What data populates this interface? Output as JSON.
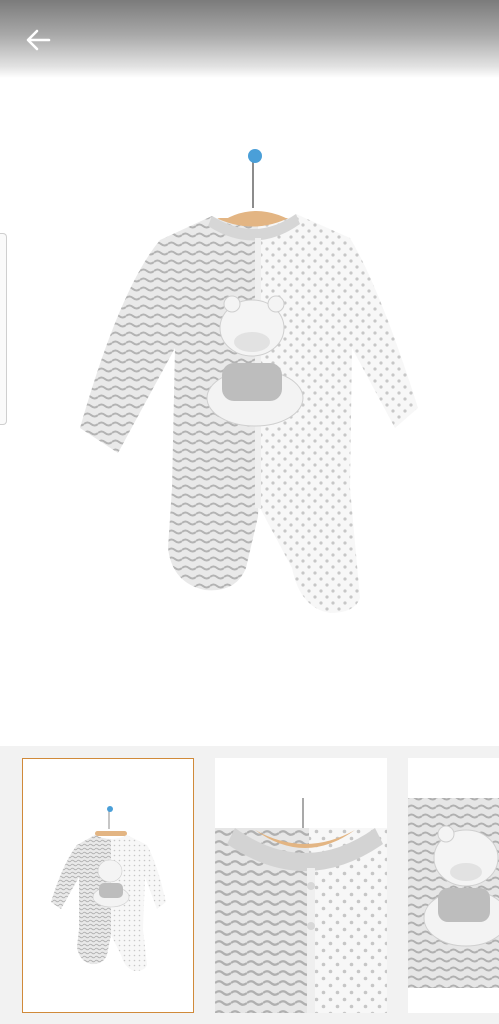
{
  "header": {
    "back_icon": "arrow-left-icon"
  },
  "product_images": {
    "main_alt": "",
    "thumbnails": [
      {
        "view": "full-romper",
        "selected": true
      },
      {
        "view": "collar-closeup",
        "selected": false
      },
      {
        "view": "front-closeup",
        "selected": false
      }
    ]
  },
  "colors": {
    "accent_border": "#d08a3a",
    "hanger_wood": "#e3b583",
    "hanger_knob": "#4a9fd8",
    "strip_bg": "#f2f2f2"
  }
}
